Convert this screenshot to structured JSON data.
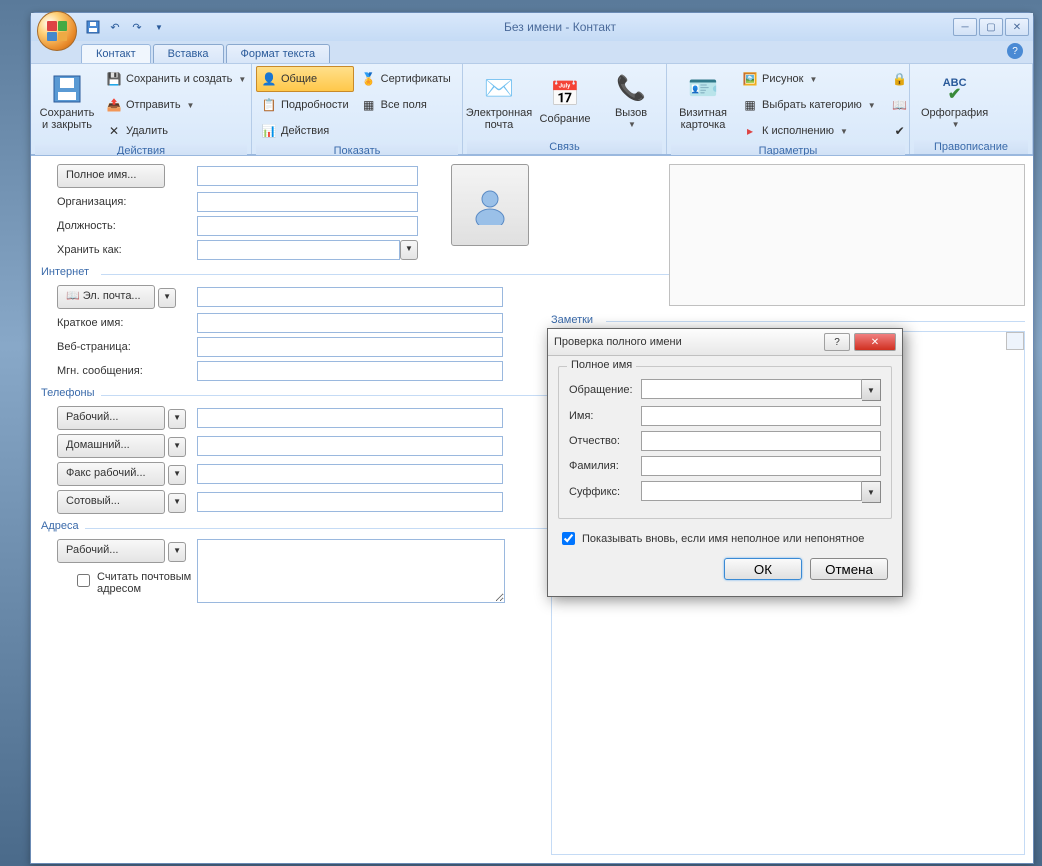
{
  "window": {
    "title": "Без имени - Контакт"
  },
  "tabs": {
    "contact": "Контакт",
    "insert": "Вставка",
    "format": "Формат текста"
  },
  "ribbon": {
    "actions": {
      "label": "Действия",
      "save_close": "Сохранить\nи закрыть",
      "save_new": "Сохранить и создать",
      "send": "Отправить",
      "delete": "Удалить"
    },
    "show": {
      "label": "Показать",
      "general": "Общие",
      "details": "Подробности",
      "activities": "Действия",
      "certs": "Сертификаты",
      "allfields": "Все поля"
    },
    "comm": {
      "label": "Связь",
      "email": "Электронная\nпочта",
      "meeting": "Собрание",
      "call": "Вызов"
    },
    "options": {
      "label": "Параметры",
      "bizcard": "Визитная\nкарточка",
      "picture": "Рисунок",
      "category": "Выбрать категорию",
      "followup": "К исполнению"
    },
    "proof": {
      "label": "Правописание",
      "spell": "Орфография"
    }
  },
  "form": {
    "fullname_btn": "Полное имя...",
    "org": "Организация:",
    "job": "Должность:",
    "fileas": "Хранить как:",
    "internet": "Интернет",
    "email_btn": "Эл. почта...",
    "displayname": "Краткое имя:",
    "web": "Веб-страница:",
    "im": "Мгн. сообщения:",
    "phones": "Телефоны",
    "phone_work": "Рабочий...",
    "phone_home": "Домашний...",
    "phone_fax": "Факс рабочий...",
    "phone_mobile": "Сотовый...",
    "addresses": "Адреса",
    "addr_work": "Рабочий...",
    "mailing": "Считать почтовым адресом",
    "notes": "Заметки"
  },
  "dialog": {
    "title": "Проверка полного имени",
    "group": "Полное имя",
    "salutation": "Обращение:",
    "first": "Имя:",
    "middle": "Отчество:",
    "last": "Фамилия:",
    "suffix": "Суффикс:",
    "showagain": "Показывать вновь, если имя неполное или непонятное",
    "ok": "ОК",
    "cancel": "Отмена"
  }
}
